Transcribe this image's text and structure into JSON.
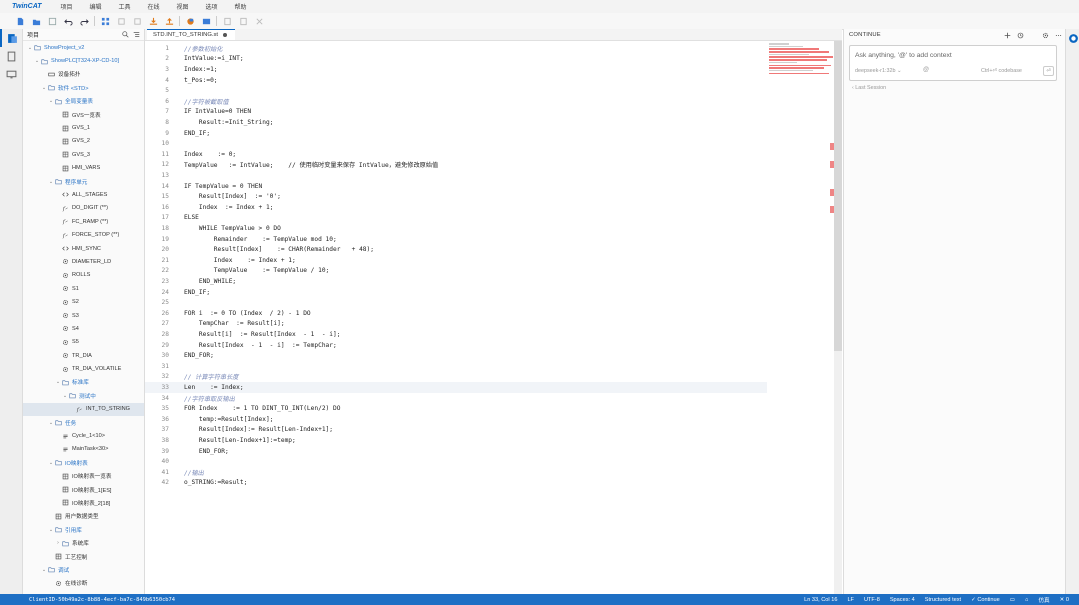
{
  "menubar": {
    "logo": "TwinCAT",
    "items": [
      "项目",
      "编辑",
      "工具",
      "在线",
      "视图",
      "选项",
      "帮助"
    ]
  },
  "explorer": {
    "title": "项目",
    "tree": [
      {
        "label": "ShowProject_v2",
        "depth": 0,
        "chev": "v",
        "icon": "folder",
        "blue": true
      },
      {
        "label": "ShowPLC[T324-XP-CD-10]",
        "depth": 1,
        "chev": "v",
        "icon": "folder",
        "blue": true
      },
      {
        "label": "设备拓扑",
        "depth": 2,
        "chev": "",
        "icon": "device"
      },
      {
        "label": "软件 <STD>",
        "depth": 2,
        "chev": "v",
        "icon": "folder",
        "blue": true
      },
      {
        "label": "全局变量表",
        "depth": 3,
        "chev": "v",
        "icon": "folder",
        "blue": true
      },
      {
        "label": "GVS一览表",
        "depth": 4,
        "chev": "",
        "icon": "table"
      },
      {
        "label": "GVS_1",
        "depth": 4,
        "chev": "",
        "icon": "table"
      },
      {
        "label": "GVS_2",
        "depth": 4,
        "chev": "",
        "icon": "table"
      },
      {
        "label": "GVS_3",
        "depth": 4,
        "chev": "",
        "icon": "table"
      },
      {
        "label": "HMI_VARS",
        "depth": 4,
        "chev": "",
        "icon": "table"
      },
      {
        "label": "程序单元",
        "depth": 3,
        "chev": "v",
        "icon": "folder",
        "blue": true
      },
      {
        "label": "ALL_STAGES",
        "depth": 4,
        "chev": "",
        "icon": "code"
      },
      {
        "label": "DO_DIGIT (**)",
        "depth": 4,
        "chev": "",
        "icon": "func"
      },
      {
        "label": "FC_RAMP (**)",
        "depth": 4,
        "chev": "",
        "icon": "func"
      },
      {
        "label": "FORCE_STOP (**)",
        "depth": 4,
        "chev": "",
        "icon": "func"
      },
      {
        "label": "HMI_SYNC",
        "depth": 4,
        "chev": "",
        "icon": "code"
      },
      {
        "label": "DIAMETER_LD",
        "depth": 4,
        "chev": "",
        "icon": "gear"
      },
      {
        "label": "ROLLS",
        "depth": 4,
        "chev": "",
        "icon": "gear"
      },
      {
        "label": "S1",
        "depth": 4,
        "chev": "",
        "icon": "gear"
      },
      {
        "label": "S2",
        "depth": 4,
        "chev": "",
        "icon": "gear"
      },
      {
        "label": "S3",
        "depth": 4,
        "chev": "",
        "icon": "gear"
      },
      {
        "label": "S4",
        "depth": 4,
        "chev": "",
        "icon": "gear"
      },
      {
        "label": "S5",
        "depth": 4,
        "chev": "",
        "icon": "gear"
      },
      {
        "label": "TR_DIA",
        "depth": 4,
        "chev": "",
        "icon": "gear"
      },
      {
        "label": "TR_DIA_VOLATILE",
        "depth": 4,
        "chev": "",
        "icon": "gear"
      },
      {
        "label": "标准库",
        "depth": 4,
        "chev": "v",
        "icon": "folder",
        "blue": true
      },
      {
        "label": "测试中",
        "depth": 5,
        "chev": "v",
        "icon": "folder",
        "blue": true
      },
      {
        "label": "INT_TO_STRING",
        "depth": 6,
        "chev": "",
        "icon": "func",
        "selected": true
      },
      {
        "label": "任务",
        "depth": 3,
        "chev": "v",
        "icon": "folder",
        "blue": true
      },
      {
        "label": "Cycle_1<10>",
        "depth": 4,
        "chev": "",
        "icon": "task"
      },
      {
        "label": "MainTask<30>",
        "depth": 4,
        "chev": "",
        "icon": "task"
      },
      {
        "label": "IO映射表",
        "depth": 3,
        "chev": "v",
        "icon": "folder",
        "blue": true
      },
      {
        "label": "IO映射表一览表",
        "depth": 4,
        "chev": "",
        "icon": "table"
      },
      {
        "label": "IO映射表_1[ES]",
        "depth": 4,
        "chev": "",
        "icon": "table"
      },
      {
        "label": "IO映射表_2[18]",
        "depth": 4,
        "chev": "",
        "icon": "table"
      },
      {
        "label": "用户数据类型",
        "depth": 3,
        "chev": "",
        "icon": "table"
      },
      {
        "label": "引用库",
        "depth": 3,
        "chev": "v",
        "icon": "folder",
        "blue": true
      },
      {
        "label": "系统库",
        "depth": 4,
        "chev": ">",
        "icon": "folder"
      },
      {
        "label": "工艺控制",
        "depth": 3,
        "chev": "",
        "icon": "table"
      },
      {
        "label": "调试",
        "depth": 2,
        "chev": "v",
        "icon": "folder",
        "blue": true
      },
      {
        "label": "在线诊断",
        "depth": 3,
        "chev": "",
        "icon": "gear"
      }
    ]
  },
  "editor": {
    "tab_label": "STD.INT_TO_STRING.st",
    "lines": [
      {
        "n": "1",
        "text": "//参数初始化",
        "comment": true
      },
      {
        "n": "2",
        "text": "IntValue:=i_INT;"
      },
      {
        "n": "3",
        "text": "Index:=1;"
      },
      {
        "n": "4",
        "text": "t_Pos:=0;"
      },
      {
        "n": "5",
        "text": ""
      },
      {
        "n": "6",
        "text": "//字符被截取值",
        "comment": true
      },
      {
        "n": "7",
        "text": "IF IntValue=0 THEN"
      },
      {
        "n": "8",
        "text": "    Result:=Init_String;"
      },
      {
        "n": "9",
        "text": "END_IF;"
      },
      {
        "n": "10",
        "text": ""
      },
      {
        "n": "11",
        "text": "Index    := 0;"
      },
      {
        "n": "12",
        "text": "TempValue   := IntValue;    // 使用临时变量来保存 IntValue，避免修改原始值"
      },
      {
        "n": "13",
        "text": ""
      },
      {
        "n": "14",
        "text": "IF TempValue = 0 THEN"
      },
      {
        "n": "15",
        "text": "    Result[Index]  := '0';"
      },
      {
        "n": "16",
        "text": "    Index  := Index + 1;"
      },
      {
        "n": "17",
        "text": "ELSE"
      },
      {
        "n": "18",
        "text": "    WHILE TempValue > 0 DO"
      },
      {
        "n": "19",
        "text": "        Remainder    := TempValue mod 10;"
      },
      {
        "n": "20",
        "text": "        Result[Index]    := CHAR(Remainder   + 48);"
      },
      {
        "n": "21",
        "text": "        Index    := Index + 1;"
      },
      {
        "n": "22",
        "text": "        TempValue    := TempValue / 10;"
      },
      {
        "n": "23",
        "text": "    END_WHILE;"
      },
      {
        "n": "24",
        "text": "END_IF;"
      },
      {
        "n": "25",
        "text": ""
      },
      {
        "n": "26",
        "text": "FOR i  := 0 TO (Index  / 2) - 1 DO"
      },
      {
        "n": "27",
        "text": "    TempChar  := Result[i];"
      },
      {
        "n": "28",
        "text": "    Result[i]  := Result[Index  - 1  - i];"
      },
      {
        "n": "29",
        "text": "    Result[Index  - 1  - i]  := TempChar;"
      },
      {
        "n": "30",
        "text": "END_FOR;"
      },
      {
        "n": "31",
        "text": ""
      },
      {
        "n": "32",
        "text": "// 计算字符串长度",
        "comment": true
      },
      {
        "n": "33",
        "text": "Len    := Index;"
      },
      {
        "n": "34",
        "text": "//字符串取反输出",
        "comment": true
      },
      {
        "n": "35",
        "text": "FOR Index    := 1 TO DINT_TO_INT(Len/2) DO"
      },
      {
        "n": "36",
        "text": "    temp:=Result[Index];"
      },
      {
        "n": "37",
        "text": "    Result[Index]:= Result[Len-Index+1];"
      },
      {
        "n": "38",
        "text": "    Result[Len-Index+1]:=temp;"
      },
      {
        "n": "39",
        "text": "    END_FOR;"
      },
      {
        "n": "40",
        "text": ""
      },
      {
        "n": "41",
        "text": "//输出",
        "comment": true
      },
      {
        "n": "42",
        "text": "o_STRING:=Result;"
      }
    ]
  },
  "continue_panel": {
    "title": "CONTINUE",
    "placeholder": "Ask anything, '@' to add context",
    "model": "deepseek-r1:32b ⌄",
    "at_symbol": "@",
    "codebase": "Ctrl+⏎ codebase",
    "enter": "⏎",
    "last_session": "Last Session"
  },
  "statusbar": {
    "left": "ClientID-50b49a2c-8b88-4ecf-ba7c-849b6350cb74",
    "items": [
      "Ln 33, Col 16",
      "LF",
      "UTF-8",
      "Spaces: 4",
      "Structured text",
      "✓ Continue",
      "仿真",
      "✕ 0"
    ]
  },
  "colors": {
    "accent": "#1e6fc4",
    "tree_blue": "#2a74c6",
    "error_red": "#ef8585"
  }
}
